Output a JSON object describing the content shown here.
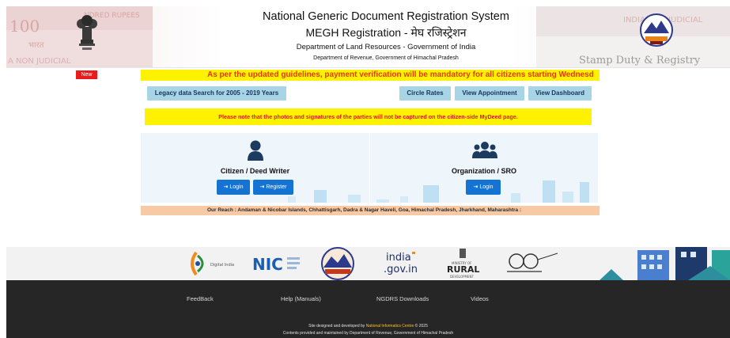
{
  "header": {
    "title": "National Generic Document Registration System",
    "subtitle": "MEGH Registration - मेघ रजिस्ट्रेशन",
    "department": "Department of Land Resources - Government of India",
    "state_department": "Department of Revenue, Government of Himachal Pradesh",
    "stamp_left_text": "100",
    "stamp_left_band": "NDRED RUPEES",
    "stamp_left_hindi": "भारत",
    "stamp_left_nonjudicial": "A NON JUDICIAL",
    "stamp_right_text": "INDIA NON JUDICIAL",
    "stamp_right_caption": "Stamp Duty & Registry"
  },
  "alert": {
    "new_badge": "New",
    "marquee_text": "As per the updated guidelines, payment verification will be mandatory for all citizens starting Wednesd"
  },
  "actions": {
    "legacy_search": "Legacy data Search for 2005 - 2019 Years",
    "circle_rates": "Circle Rates",
    "view_appointment": "View Appointment",
    "view_dashboard": "View Dashboard"
  },
  "notice_text": "Please note that the photos and signatures of the parties will not be captured on the citizen-side MyDeed page.",
  "panels": {
    "citizen": {
      "title": "Citizen / Deed Writer",
      "login": "Login",
      "register": "Register"
    },
    "organization": {
      "title": "Organization / SRO",
      "login": "Login"
    }
  },
  "reach_text": "Our Reach : Andaman & Nicobar Islands,  Chhattisgarh, Dadra & Nagar Haveli, Goa, Himachal Pradesh, Jharkhand, Maharashtra :",
  "logos": {
    "digital_india": "Digital India",
    "nic": "NIC",
    "india_gov_1": "india",
    "india_gov_2": ".gov.in",
    "rural_small": "MINISTRY OF",
    "rural": "RURAL",
    "rural_sub": "DEVELOPMENT"
  },
  "footer": {
    "links": [
      "FeedBack",
      "Help (Manuals)",
      "NGDRS Downloads",
      "Videos"
    ],
    "designed_prefix": "Site designed and developed by",
    "designed_org": "National Informatics Centre",
    "designed_suffix": "© 2025",
    "maintained_prefix": "Contents provided and maintained by",
    "maintained_org": "Department of Revenue, Government of Himachal Pradesh"
  },
  "colors": {
    "accent_blue": "#1574d3",
    "alert_yellow": "#fff200",
    "alert_red": "#e23b0b",
    "footer_bg": "#262626",
    "button_bg": "#a8d5e6"
  }
}
